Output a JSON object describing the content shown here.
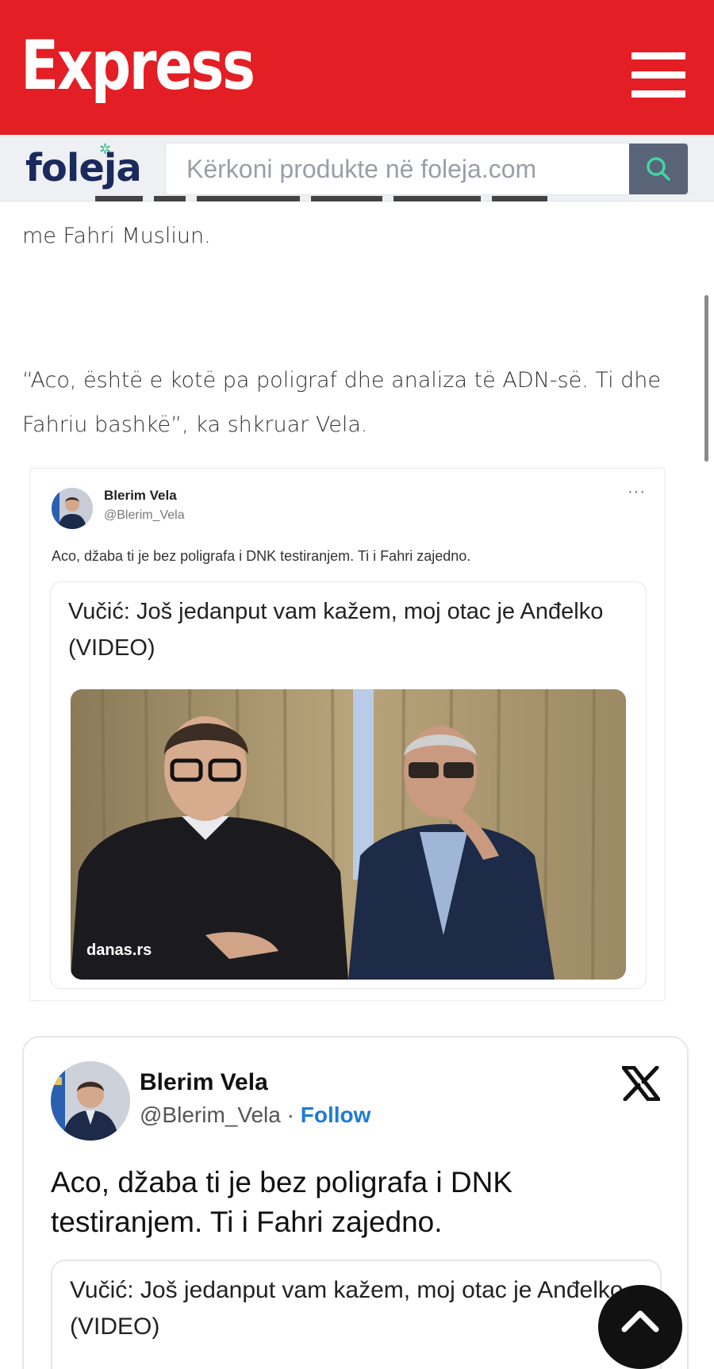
{
  "header": {
    "logo": "Express",
    "menu_icon": "hamburger-menu-icon",
    "brand_color": "#e31e24"
  },
  "foleja": {
    "logo": "foleja",
    "search_placeholder": "Kërkoni produkte në foleja.com",
    "search_icon": "search-icon"
  },
  "article": {
    "paragraph_1": "me Fahri Musliun.",
    "paragraph_2_line_1": "“Aco, është e kotë pa poligraf dhe analiza të ADN-së. Ti dhe",
    "paragraph_2_line_2": "Fahriu bashkë”, ka shkruar Vela."
  },
  "tweet_screenshot": {
    "name": "Blerim Vela",
    "handle": "@Blerim_Vela",
    "more": "···",
    "text": "Aco, džaba ti je bez poligrafa i DNK testiranjem. Ti i Fahri zajedno.",
    "card_title": "Vučić: Još jedanput vam kažem, moj otac je Anđelko (VIDEO)",
    "card_source": "danas.rs"
  },
  "tweet_embed": {
    "name": "Blerim Vela",
    "handle": "@Blerim_Vela",
    "separator": " · ",
    "follow_label": "Follow",
    "x_icon": "x-logo-icon",
    "text": "Aco, džaba ti je bez poligrafa i DNK testiranjem. Ti i Fahri zajedno.",
    "card_title": "Vučić: Još jedanput vam kažem, moj otac je Anđelko (VIDEO)",
    "link_color": "#1d7bd7"
  },
  "scroll_to_top_icon": "chevron-up-icon"
}
